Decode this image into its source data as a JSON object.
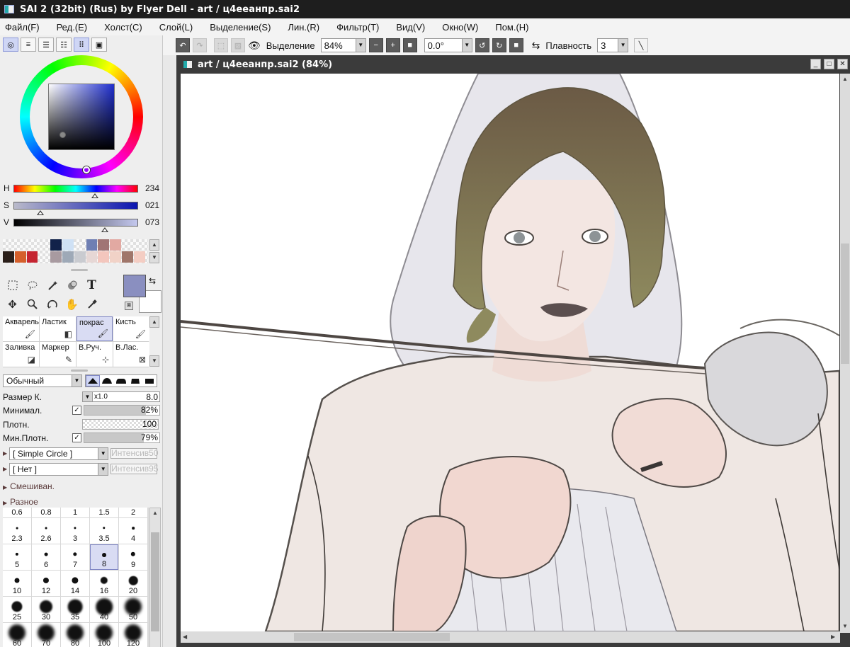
{
  "window": {
    "title": "SAI 2 (32bit) (Rus) by Flyer Dell - art / ц4ееанпр.sai2"
  },
  "menu": [
    "Файл(F)",
    "Ред.(E)",
    "Холст(C)",
    "Слой(L)",
    "Выделение(S)",
    "Лин.(R)",
    "Фильтр(T)",
    "Вид(V)",
    "Окно(W)",
    "Пом.(H)"
  ],
  "color_panel": {
    "h": {
      "label": "H",
      "value": "234",
      "fraction": 0.65
    },
    "s": {
      "label": "S",
      "value": "021",
      "fraction": 0.21
    },
    "v": {
      "label": "V",
      "value": "073",
      "fraction": 0.73
    },
    "swatches": [
      "",
      "",
      "",
      "",
      "#12224a",
      "#cfe1f5",
      "",
      "#6f7fb3",
      "#a07575",
      "#e2a9a2",
      "",
      "",
      "",
      "#2b1f1a",
      "#d55f2b",
      "#c52431",
      "",
      "#a89aa0",
      "#9ea9b7",
      "#c9cbd0",
      "#e6d7d5",
      "#f3c6bd",
      "#f1d2c7",
      "#a0766a",
      "#f4cdc3",
      ""
    ],
    "fg_color": "#8a8fc0",
    "bg_color": "#ffffff"
  },
  "tools": [
    "select-rect",
    "lasso",
    "magic-wand",
    "shape",
    "text",
    "move",
    "zoom",
    "rotate",
    "hand",
    "eyedropper"
  ],
  "brushes": [
    {
      "label": "Акварель",
      "icon": "watercolor-brush-icon"
    },
    {
      "label": "Ластик",
      "icon": "eraser-icon"
    },
    {
      "label": "покрас",
      "icon": "paint-brush-icon",
      "active": true
    },
    {
      "label": "Кисть",
      "icon": "brush-icon"
    },
    {
      "label": "Заливка",
      "icon": "bucket-fill-icon"
    },
    {
      "label": "Маркер",
      "icon": "marker-icon"
    },
    {
      "label": "В.Руч.",
      "icon": "select-pen-icon"
    },
    {
      "label": "В.Лас.",
      "icon": "select-eraser-icon"
    }
  ],
  "brush_settings": {
    "blend_mode": "Обычный",
    "size_label": "Размер К.",
    "size_multiplier": "x1.0",
    "size_value": "8.0",
    "min_size_label": "Минимал.",
    "min_size_value": "82%",
    "density_label": "Плотн.",
    "density_value": "100",
    "min_density_label": "Мин.Плотн.",
    "min_density_value": "79%",
    "shape": "[ Simple Circle ]",
    "shape_intensity_label": "Интенсив",
    "shape_intensity": "50",
    "texture": "[ Нет ]",
    "texture_intensity_label": "Интенсив",
    "texture_intensity": "95",
    "mixing_label": "Смешиван.",
    "misc_label": "Разное"
  },
  "size_presets": [
    "0.6",
    "0.8",
    "1",
    "1.5",
    "2",
    "2.3",
    "2.6",
    "3",
    "3.5",
    "4",
    "5",
    "6",
    "7",
    "8",
    "9",
    "10",
    "12",
    "14",
    "16",
    "20",
    "25",
    "30",
    "35",
    "40",
    "50",
    "60",
    "70",
    "80",
    "100",
    "120"
  ],
  "size_selected": "8",
  "toolbar": {
    "selection_label": "Выделение",
    "zoom_value": "84%",
    "rotation_value": "0.0°",
    "smoothing_label": "Плавность",
    "smoothing_value": "3"
  },
  "canvas_window": {
    "title": "art / ц4ееанпр.sai2 (84%)"
  }
}
